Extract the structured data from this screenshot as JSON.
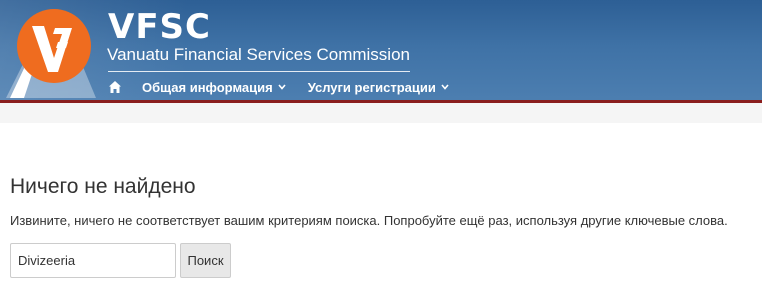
{
  "header": {
    "brand_title": "VFSC",
    "brand_subtitle": "Vanuatu Financial Services Commission",
    "colors": {
      "header_blue": "#3f72a6",
      "accent_border": "#8a1e1e",
      "logo_orange": "#ef6c1f"
    },
    "logo_icon": "vfsc-logo-icon"
  },
  "nav": {
    "home_icon": "home-icon",
    "items": [
      {
        "label": "Общая информация",
        "icon": "chevron-down-icon"
      },
      {
        "label": "Услуги регистрации",
        "icon": "chevron-down-icon"
      }
    ]
  },
  "main": {
    "title": "Ничего не найдено",
    "message": "Извините, ничего не соответствует вашим критериям поиска. Попробуйте ещё раз, используя другие ключевые слова.",
    "search": {
      "value": "Divizeeria",
      "button_label": "Поиск"
    }
  }
}
